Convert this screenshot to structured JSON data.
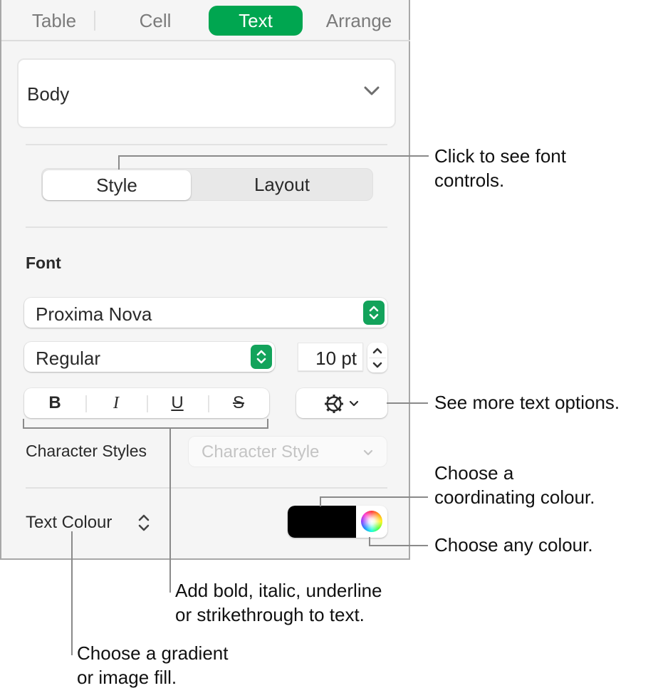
{
  "tabs": [
    {
      "label": "Table",
      "active": false
    },
    {
      "label": "Cell",
      "active": false
    },
    {
      "label": "Text",
      "active": true
    },
    {
      "label": "Arrange",
      "active": false
    }
  ],
  "paragraph_style": {
    "value": "Body"
  },
  "segmented": {
    "style_label": "Style",
    "layout_label": "Layout",
    "selected": "Style"
  },
  "font_section": {
    "title": "Font",
    "font_family": "Proxima Nova",
    "typeface": "Regular",
    "size": "10 pt"
  },
  "format_buttons": [
    {
      "label": "B",
      "name": "bold"
    },
    {
      "label": "I",
      "name": "italic"
    },
    {
      "label": "U",
      "name": "underline"
    },
    {
      "label": "S",
      "name": "strikethrough"
    }
  ],
  "character_styles": {
    "label": "Character Styles",
    "placeholder": "Character Style"
  },
  "text_colour": {
    "label": "Text Colour",
    "swatch_color": "#000000"
  },
  "colors": {
    "accent": "#00a650",
    "stepper_green": "#13a35b"
  },
  "callouts": {
    "font_controls": [
      "Click to see font",
      "controls."
    ],
    "more_options": [
      "See more text options."
    ],
    "coordinating": [
      "Choose a",
      "coordinating colour."
    ],
    "any_colour": [
      "Choose any colour."
    ],
    "format": [
      "Add bold, italic, underline",
      "or strikethrough to text."
    ],
    "fill": [
      "Choose a gradient",
      "or image fill."
    ]
  }
}
